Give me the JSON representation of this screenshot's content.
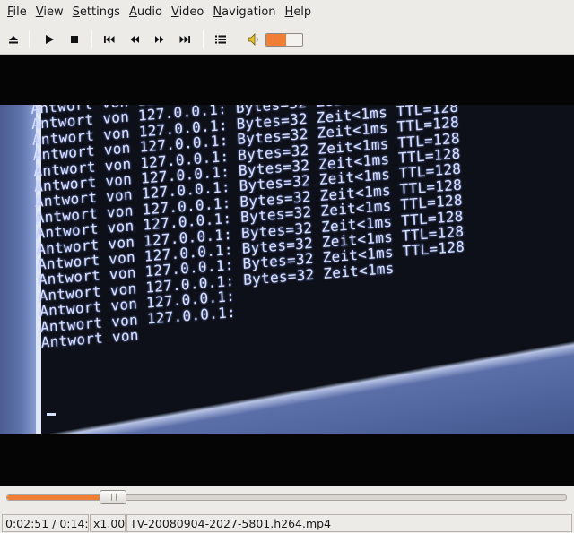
{
  "menubar": {
    "items": [
      {
        "label": "File",
        "key": "F",
        "rest": "ile"
      },
      {
        "label": "View",
        "key": "V",
        "rest": "iew"
      },
      {
        "label": "Settings",
        "key": "S",
        "rest": "ettings"
      },
      {
        "label": "Audio",
        "key": "A",
        "rest": "udio"
      },
      {
        "label": "Video",
        "key": "V",
        "rest": "ideo"
      },
      {
        "label": "Navigation",
        "key": "N",
        "rest": "avigation"
      },
      {
        "label": "Help",
        "key": "H",
        "rest": "elp"
      }
    ]
  },
  "toolbar": {
    "icons": [
      "eject-icon",
      "play-icon",
      "stop-icon",
      "skip-back-icon",
      "rewind-icon",
      "fast-forward-icon",
      "skip-forward-icon",
      "playlist-icon",
      "speaker-icon"
    ],
    "volume_level": 0.55,
    "accent": "#f07f35"
  },
  "video": {
    "lines": [
      "Antwort von 127.0.0.1: Bytes=32 Zeit<1ms TTL=128",
      "Antwort von 127.0.0.1: Bytes=32 Zeit<1ms TTL=128",
      "Antwort von 127.0.0.1: Bytes=32 Zeit<1ms TTL=128",
      "Antwort von 127.0.0.1: Bytes=32 Zeit<1ms TTL=128",
      "Antwort von 127.0.0.1: Bytes=32 Zeit<1ms TTL=128",
      "Antwort von 127.0.0.1: Bytes=32 Zeit<1ms TTL=128",
      "Antwort von 127.0.0.1: Bytes=32 Zeit<1ms TTL=128",
      "Antwort von 127.0.0.1: Bytes=32 Zeit<1ms TTL=128",
      "Antwort von 127.0.0.1: Bytes=32 Zeit<1ms TTL=128",
      "Antwort von 127.0.0.1: Bytes=32 Zeit<1ms TTL=128",
      "Antwort von 127.0.0.1: Bytes=32 Zeit<1ms TTL=128",
      "Antwort von 127.0.0.1: Bytes=32 Zeit<1ms TTL=128",
      "Antwort von 127.0.0.1: Bytes=32 Zeit<1ms",
      "Antwort von 127.0.0.1:",
      "Antwort von 127.0.0.1:",
      "Antwort von"
    ]
  },
  "seek": {
    "progress": 0.19
  },
  "status": {
    "time": "0:02:51 / 0:14:",
    "speed": "x1.00",
    "filename": "TV-20080904-2027-5801.h264.mp4"
  }
}
